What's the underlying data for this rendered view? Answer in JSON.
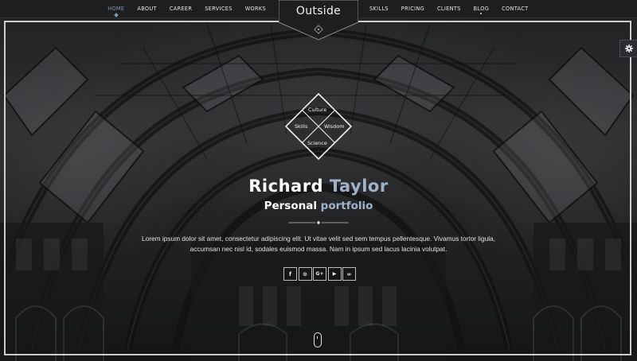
{
  "nav": {
    "left": [
      {
        "label": "HOME",
        "active": true
      },
      {
        "label": "ABOUT"
      },
      {
        "label": "CAREER"
      },
      {
        "label": "SERVICES"
      },
      {
        "label": "WORKS"
      }
    ],
    "right": [
      {
        "label": "SKILLS"
      },
      {
        "label": "PRICING"
      },
      {
        "label": "CLIENTS"
      },
      {
        "label": "BLOG",
        "has_submenu": true
      },
      {
        "label": "CONTACT"
      }
    ]
  },
  "brand": {
    "title": "Outside"
  },
  "diamond": {
    "top": "Culture",
    "left": "Skills",
    "right": "Wisdom",
    "bottom": "Science"
  },
  "hero": {
    "name_first": "Richard",
    "name_last": "Taylor",
    "subtitle_main": "Personal",
    "subtitle_accent": "portfolio",
    "description_line1": "Lorem ipsum dolor sit amet, consectetur adipiscing elit. Ut vitae velit sed sem tempus pellentesque. Vivamus tortor ligula,",
    "description_line2": "accumsan nec nisl id, sodales euismod massa. Nam in ipsum sed lacus lacinia volutpat."
  },
  "social": [
    {
      "icon": "facebook-icon",
      "glyph": "f"
    },
    {
      "icon": "github-icon",
      "glyph": "⊙"
    },
    {
      "icon": "google-plus-icon",
      "glyph": "G+"
    },
    {
      "icon": "youtube-icon",
      "glyph": "▶"
    },
    {
      "icon": "lastfm-icon",
      "glyph": "∞"
    }
  ],
  "colors": {
    "accent": "#9fb3c8",
    "nav_active": "#7e96ad",
    "navbar_bg": "#1d1e20"
  }
}
